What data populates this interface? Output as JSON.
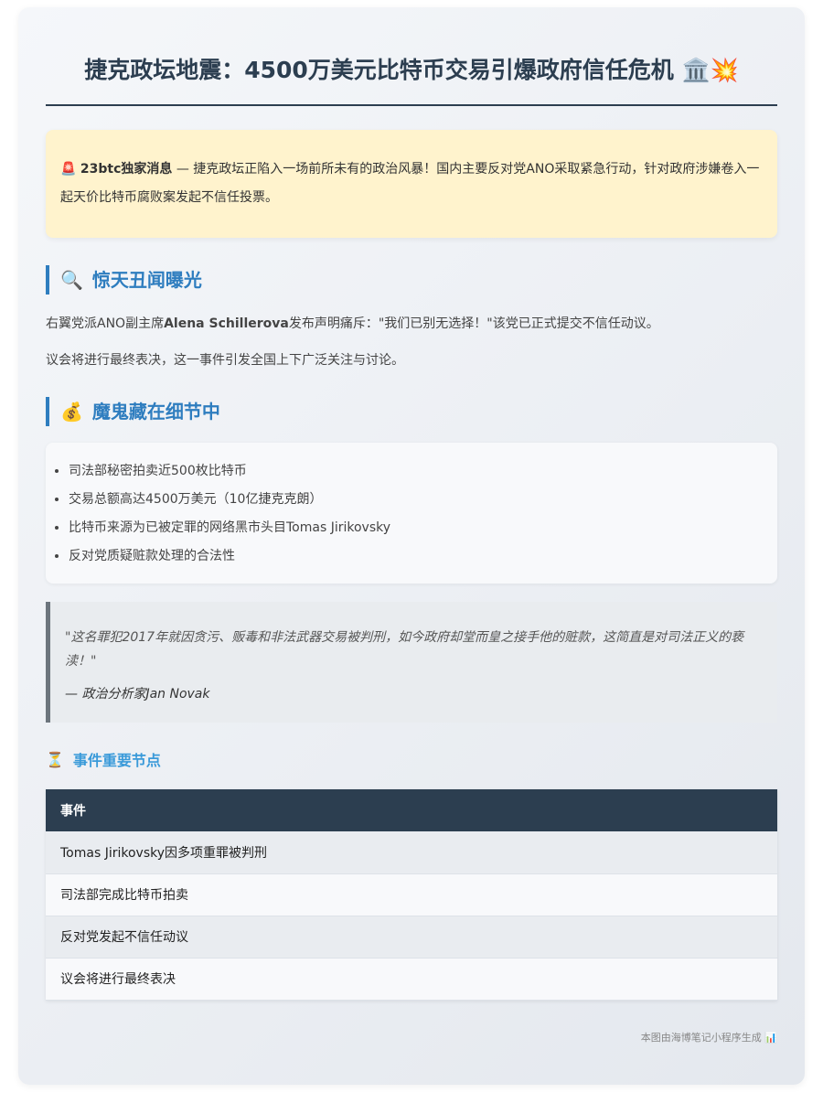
{
  "header": {
    "title": "捷克政坛地震：4500万美元比特币交易引爆政府信任危机",
    "title_icons": "🏛️💥"
  },
  "alert": {
    "icon": "🚨",
    "source": "23btc独家消息",
    "text": " — 捷克政坛正陷入一场前所未有的政治风暴！国内主要反对党ANO采取紧急行动，针对政府涉嫌卷入一起天价比特币腐败案发起不信任投票。"
  },
  "section1": {
    "icon": "🔍",
    "heading": "惊天丑闻曝光",
    "p1_prefix": "右翼党派ANO副主席",
    "p1_name": "Alena Schillerova",
    "p1_suffix": "发布声明痛斥：\"我们已别无选择！\"该党已正式提交不信任动议。",
    "p2": "议会将进行最终表决，这一事件引发全国上下广泛关注与讨论。"
  },
  "section2": {
    "icon": "💰",
    "heading": "魔鬼藏在细节中",
    "items": [
      "司法部秘密拍卖近500枚比特币",
      "交易总额高达4500万美元（10亿捷克克朗）",
      "比特币来源为已被定罪的网络黑市头目Tomas Jirikovsky",
      "反对党质疑赃款处理的合法性"
    ]
  },
  "quote": {
    "text": "\"这名罪犯2017年就因贪污、贩毒和非法武器交易被判刑，如今政府却堂而皇之接手他的赃款，这简直是对司法正义的亵渎！\"",
    "author": "— 政治分析家Jan Novak"
  },
  "timeline": {
    "icon": "⏳",
    "heading": "事件重要节点",
    "column": "事件",
    "rows": [
      "Tomas Jirikovsky因多项重罪被判刑",
      "司法部完成比特币拍卖",
      "反对党发起不信任动议",
      "议会将进行最终表决"
    ]
  },
  "footer": {
    "text": "本图由海博笔记小程序生成",
    "icon": "📊"
  },
  "colors": {
    "primary": "#2c3e50",
    "accent_blue": "#2e7dbf",
    "alert_bg": "#fff3cd"
  }
}
